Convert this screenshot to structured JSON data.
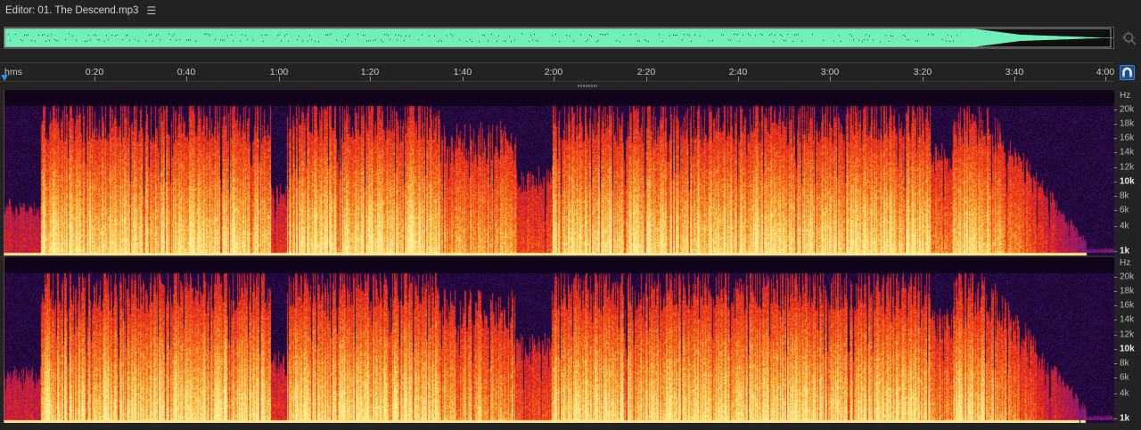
{
  "editor": {
    "title": "Editor: 01. The Descend.mp3",
    "menu_icon": "hamburger-menu-icon"
  },
  "overview": {
    "waveform_color": "#6ff0b8",
    "zoom_icon": "zoom-navigator-icon"
  },
  "timeline": {
    "unit_label": "hms",
    "ticks": [
      "0:20",
      "0:40",
      "1:00",
      "1:20",
      "1:40",
      "2:00",
      "2:20",
      "2:40",
      "3:00",
      "3:20",
      "3:40",
      "4:00"
    ],
    "snap_icon": "magnet-icon"
  },
  "spectral_display": {
    "channels": [
      "top",
      "bottom"
    ],
    "freq_unit": "Hz",
    "freq_labels": [
      "20k",
      "18k",
      "16k",
      "14k",
      "12k",
      "10k",
      "8k",
      "6k",
      "4k",
      "1k"
    ],
    "bold_labels": [
      "10k",
      "1k"
    ],
    "colormap": [
      "#050208",
      "#2a0a4a",
      "#5a1a8a",
      "#a01a60",
      "#e0201a",
      "#f86018",
      "#ffc040",
      "#fff0a0"
    ]
  }
}
